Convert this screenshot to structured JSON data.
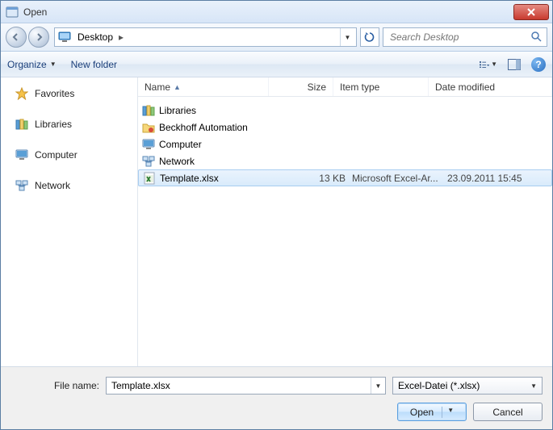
{
  "title": "Open",
  "breadcrumb": {
    "location": "Desktop"
  },
  "search": {
    "placeholder": "Search Desktop"
  },
  "toolbar": {
    "organize": "Organize",
    "newfolder": "New folder"
  },
  "sidebar": {
    "items": [
      {
        "label": "Favorites",
        "icon": "star"
      },
      {
        "label": "Libraries",
        "icon": "libraries"
      },
      {
        "label": "Computer",
        "icon": "computer"
      },
      {
        "label": "Network",
        "icon": "network"
      }
    ]
  },
  "columns": {
    "name": "Name",
    "size": "Size",
    "type": "Item type",
    "date": "Date modified"
  },
  "rows": [
    {
      "name": "Libraries",
      "size": "",
      "type": "",
      "date": "",
      "icon": "libraries",
      "selected": false
    },
    {
      "name": "Beckhoff Automation",
      "size": "",
      "type": "",
      "date": "",
      "icon": "folder-special",
      "selected": false
    },
    {
      "name": "Computer",
      "size": "",
      "type": "",
      "date": "",
      "icon": "computer",
      "selected": false
    },
    {
      "name": "Network",
      "size": "",
      "type": "",
      "date": "",
      "icon": "network",
      "selected": false
    },
    {
      "name": "Template.xlsx",
      "size": "13 KB",
      "type": "Microsoft Excel-Ar...",
      "date": "23.09.2011 15:45",
      "icon": "xlsx",
      "selected": true
    }
  ],
  "filename": {
    "label": "File name:",
    "value": "Template.xlsx"
  },
  "filter": {
    "label": "Excel-Datei (*.xlsx)"
  },
  "buttons": {
    "open": "Open",
    "cancel": "Cancel"
  }
}
